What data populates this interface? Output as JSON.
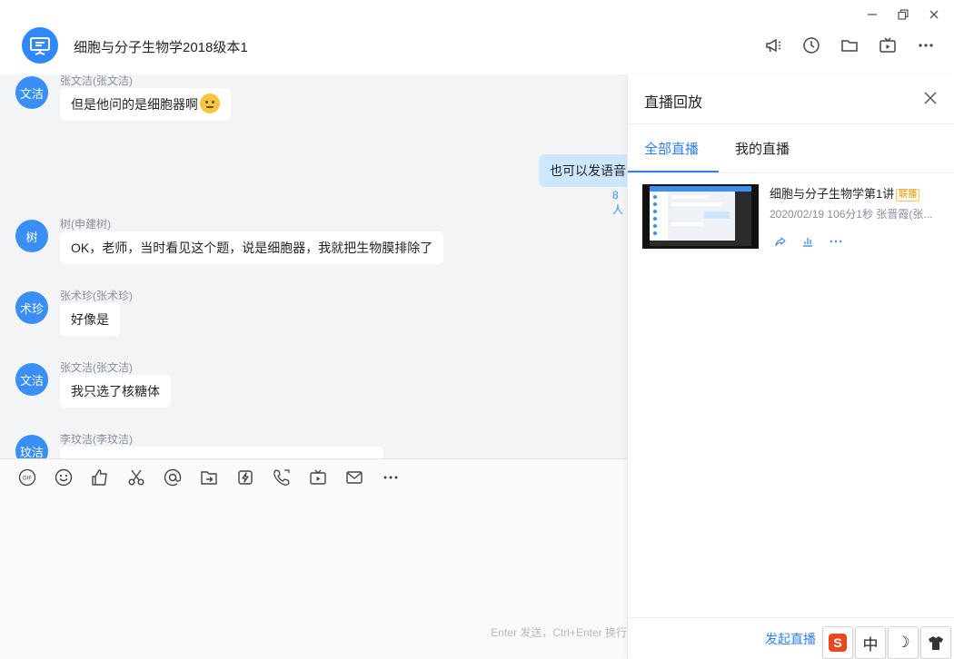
{
  "header": {
    "group_title": "细胞与分子生物学2018级本1"
  },
  "chat": {
    "messages": [
      {
        "avatar": "文洁",
        "sender": "张文洁(张文洁)",
        "text": "但是他问的是细胞器啊"
      },
      {
        "avatar": "树",
        "sender": "树(申建树)",
        "text": "OK，老师，当时看见这个题，说是细胞器，我就把生物膜排除了"
      },
      {
        "avatar": "术珍",
        "sender": "张术珍(张术珍)",
        "text": "好像是"
      },
      {
        "avatar": "文洁",
        "sender": "张文洁(张文洁)",
        "text": "我只选了核糖体"
      },
      {
        "avatar": "玟洁",
        "sender": "李玟洁(李玟洁)",
        "text": ""
      }
    ],
    "self_message": "也可以发语音",
    "read_count": "8人"
  },
  "input": {
    "hint": "Enter 发送，Ctrl+Enter 换行"
  },
  "panel": {
    "title": "直播回放",
    "tabs": [
      "全部直播",
      "我的直播"
    ],
    "video": {
      "title": "细胞与分子生物学第1讲",
      "badge": "联播",
      "meta": "2020/02/19 106分1秒 张晋霞(张..."
    },
    "start_live": "发起直播"
  },
  "ime": {
    "keys": [
      "S",
      "中",
      "☽",
      "👕"
    ]
  },
  "colors": {
    "accent": "#2f7ff0",
    "avatar": "#3a8ff7",
    "self_bubble": "#cfe6ff"
  }
}
